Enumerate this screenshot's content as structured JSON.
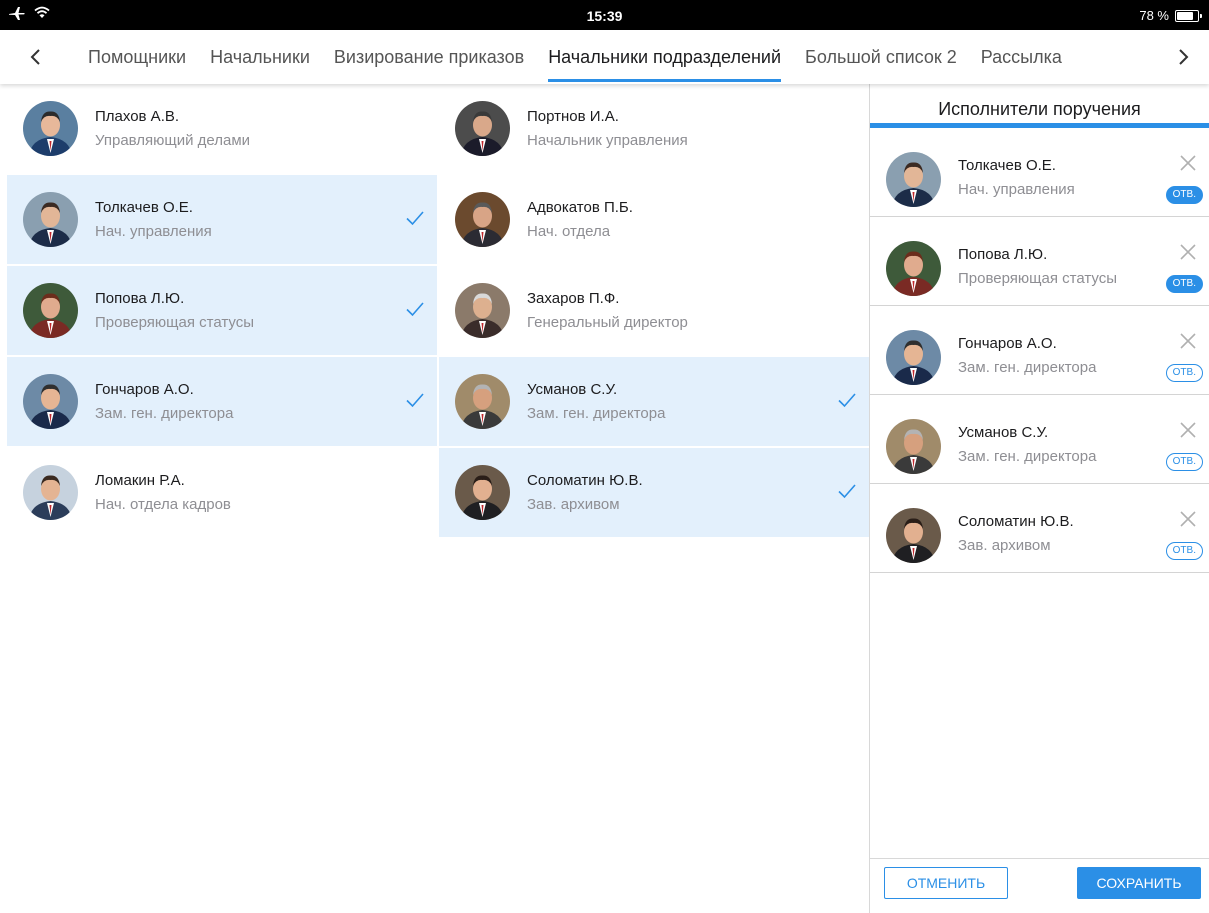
{
  "status_bar": {
    "time": "15:39",
    "battery_text": "78 %",
    "battery_level": 0.78,
    "icons": [
      "airplane-icon",
      "wifi-icon"
    ]
  },
  "tabs": [
    {
      "label": "Помощники",
      "active": false
    },
    {
      "label": "Начальники",
      "active": false
    },
    {
      "label": "Визирование приказов",
      "active": false
    },
    {
      "label": "Начальники подразделений",
      "active": true
    },
    {
      "label": "Большой список 2",
      "active": false
    },
    {
      "label": "Рассылка",
      "active": false
    }
  ],
  "people": [
    {
      "name": "Плахов А.В.",
      "role": "Управляющий делами",
      "selected": false
    },
    {
      "name": "Портнов И.А.",
      "role": "Начальник управления",
      "selected": false
    },
    {
      "name": "Толкачев О.Е.",
      "role": "Нач. управления",
      "selected": true
    },
    {
      "name": "Адвокатов П.Б.",
      "role": "Нач. отдела",
      "selected": false
    },
    {
      "name": "Попова Л.Ю.",
      "role": "Проверяющая статусы",
      "selected": true
    },
    {
      "name": "Захаров П.Ф.",
      "role": "Генеральный директор",
      "selected": false
    },
    {
      "name": "Гончаров А.О.",
      "role": "Зам. ген. директора",
      "selected": true
    },
    {
      "name": "Усманов С.У.",
      "role": "Зам. ген. директора",
      "selected": true
    },
    {
      "name": "Ломакин Р.А.",
      "role": "Нач. отдела кадров",
      "selected": false
    },
    {
      "name": "Соломатин Ю.В.",
      "role": "Зав. архивом",
      "selected": true
    }
  ],
  "panel": {
    "title": "Исполнители поручения",
    "executors": [
      {
        "name": "Толкачев О.Е.",
        "role": "Нач. управления",
        "badge": "ОТВ.",
        "responsible": true
      },
      {
        "name": "Попова Л.Ю.",
        "role": "Проверяющая статусы",
        "badge": "ОТВ.",
        "responsible": true
      },
      {
        "name": "Гончаров А.О.",
        "role": "Зам. ген. директора",
        "badge": "ОТВ.",
        "responsible": false
      },
      {
        "name": "Усманов С.У.",
        "role": "Зам. ген. директора",
        "badge": "ОТВ.",
        "responsible": false
      },
      {
        "name": "Соломатин Ю.В.",
        "role": "Зав. архивом",
        "badge": "ОТВ.",
        "responsible": false
      }
    ],
    "cancel_label": "ОТМЕНИТЬ",
    "save_label": "СОХРАНИТЬ"
  },
  "colors": {
    "accent": "#2b8fe6",
    "selected_row": "#e3f0fc",
    "secondary_text": "#8e8e93"
  }
}
